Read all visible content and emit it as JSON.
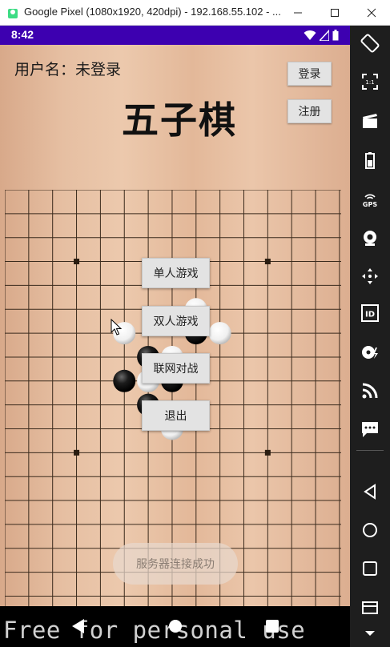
{
  "window": {
    "title": "Google Pixel (1080x1920, 420dpi) - 192.168.55.102 - ...",
    "controls": [
      "minimize",
      "maximize",
      "close"
    ]
  },
  "status_bar": {
    "time": "8:42",
    "icons": [
      "wifi-icon",
      "signal-icon",
      "battery-icon"
    ]
  },
  "app": {
    "username_label": "用户名：未登录",
    "title": "五子棋",
    "login_button": "登录",
    "register_button": "注册",
    "menu": {
      "single_player": "单人游戏",
      "two_player": "双人游戏",
      "online_battle": "联网对战",
      "exit": "退出"
    },
    "toast": "服务器连接成功",
    "board": {
      "size": 15,
      "star_points": [
        [
          3,
          3
        ],
        [
          11,
          3
        ],
        [
          3,
          11
        ],
        [
          11,
          11
        ]
      ],
      "stones": [
        {
          "col": 8,
          "row": 5,
          "color": "white"
        },
        {
          "col": 5,
          "row": 6,
          "color": "white"
        },
        {
          "col": 8,
          "row": 6,
          "color": "black"
        },
        {
          "col": 9,
          "row": 6,
          "color": "white"
        },
        {
          "col": 6,
          "row": 7,
          "color": "black"
        },
        {
          "col": 7,
          "row": 7,
          "color": "white"
        },
        {
          "col": 5,
          "row": 8,
          "color": "black"
        },
        {
          "col": 6,
          "row": 8,
          "color": "white"
        },
        {
          "col": 7,
          "row": 8,
          "color": "black"
        },
        {
          "col": 6,
          "row": 9,
          "color": "black"
        },
        {
          "col": 7,
          "row": 10,
          "color": "white"
        }
      ]
    }
  },
  "emulator_toolbar": {
    "buttons": [
      "rotate-icon",
      "fullscreen-icon",
      "screen-record-icon",
      "battery-icon",
      "gps-icon",
      "camera-icon",
      "move-icon",
      "id-icon",
      "disk-icon",
      "rss-icon",
      "sms-icon",
      "back-icon",
      "home-icon",
      "recents-icon",
      "menu-icon",
      "collapse-icon"
    ],
    "ratio_label": "1:1",
    "gps_label": "GPS",
    "id_label": "ID"
  },
  "nav_bar": {
    "buttons": [
      "back-icon",
      "home-icon",
      "recents-icon"
    ]
  },
  "watermark": "Free for personal use",
  "colors": {
    "status_bar": "#3d00b0",
    "board_line": "#3a2a1c",
    "sidebar": "#1e1e1e"
  }
}
